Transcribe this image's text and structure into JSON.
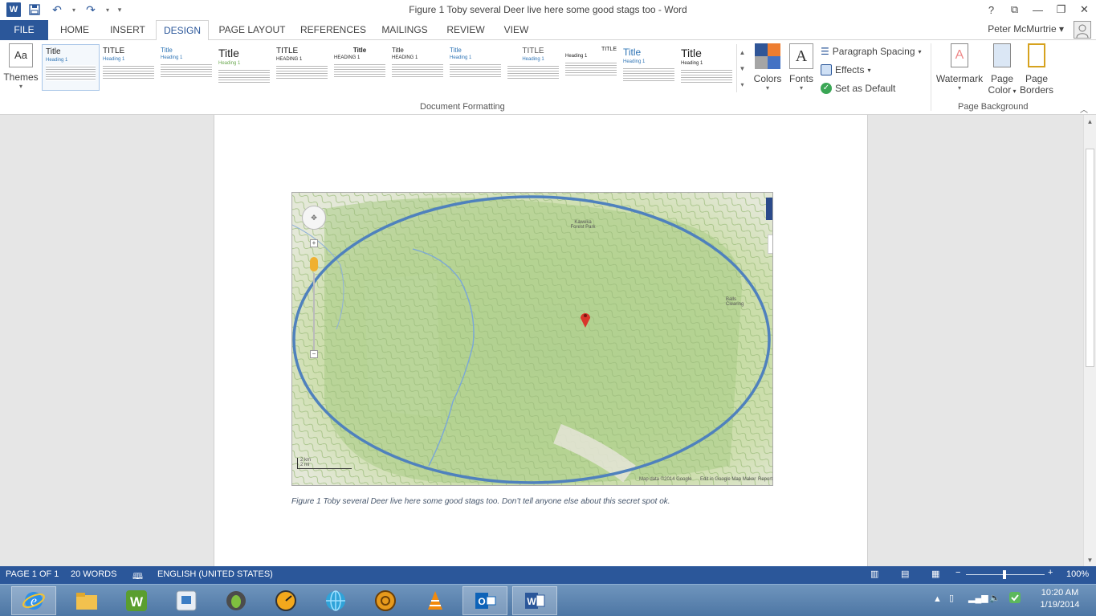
{
  "window": {
    "title": "Figure 1 Toby several Deer live here some good stags too - Word",
    "controls": [
      "?",
      "⧉",
      "—",
      "❐",
      "✕"
    ]
  },
  "tabs": [
    {
      "label": "FILE"
    },
    {
      "label": "HOME"
    },
    {
      "label": "INSERT"
    },
    {
      "label": "DESIGN"
    },
    {
      "label": "PAGE LAYOUT"
    },
    {
      "label": "REFERENCES"
    },
    {
      "label": "MAILINGS"
    },
    {
      "label": "REVIEW"
    },
    {
      "label": "VIEW"
    }
  ],
  "user": {
    "name": "Peter McMurtrie"
  },
  "ribbon": {
    "themes_label": "Themes",
    "style_gallery": [
      {
        "title": "Title",
        "heading": "Heading 1"
      },
      {
        "title": "TITLE",
        "heading": "Heading 1"
      },
      {
        "title": "Title",
        "heading": "Heading 1"
      },
      {
        "title": "Title",
        "heading": "Heading 1"
      },
      {
        "title": "TITLE",
        "heading": "HEADING 1"
      },
      {
        "title": "Title",
        "heading": "HEADING 1"
      },
      {
        "title": "Title",
        "heading": "HEADING 1"
      },
      {
        "title": "Title",
        "heading": "Heading 1"
      },
      {
        "title": "TITLE",
        "heading": "Heading 1"
      },
      {
        "title": "TITLE",
        "heading": "Heading 1"
      },
      {
        "title": "Title",
        "heading": "Heading 1"
      },
      {
        "title": "Title",
        "heading": "Heading 1"
      }
    ],
    "colors_label": "Colors",
    "fonts_label": "Fonts",
    "paragraph_spacing_label": "Paragraph Spacing",
    "effects_label": "Effects",
    "set_default_label": "Set as Default",
    "group_document_formatting": "Document Formatting",
    "watermark_label": "Watermark",
    "page_color_label_1": "Page",
    "page_color_label_2": "Color",
    "page_borders_label_1": "Page",
    "page_borders_label_2": "Borders",
    "group_page_background": "Page Background"
  },
  "map": {
    "labels": {
      "forest_park": "Kaweka Forest Park",
      "balls_clearing": "Balls Clearing",
      "scale_km": "2 km",
      "scale_mi": "2 mi",
      "attribution": "Map data ©2014 Google",
      "edit": "Edit in Google Map Maker",
      "report": "Report"
    }
  },
  "caption": "Figure 1 Toby several Deer live here some good stags too. Don’t tell anyone else about this secret spot ok.",
  "status": {
    "page": "PAGE 1 OF 1",
    "words": "20 WORDS",
    "language": "ENGLISH (UNITED STATES)",
    "zoom": "100%"
  },
  "taskbar": {
    "time": "10:20 AM",
    "date": "1/19/2014"
  }
}
